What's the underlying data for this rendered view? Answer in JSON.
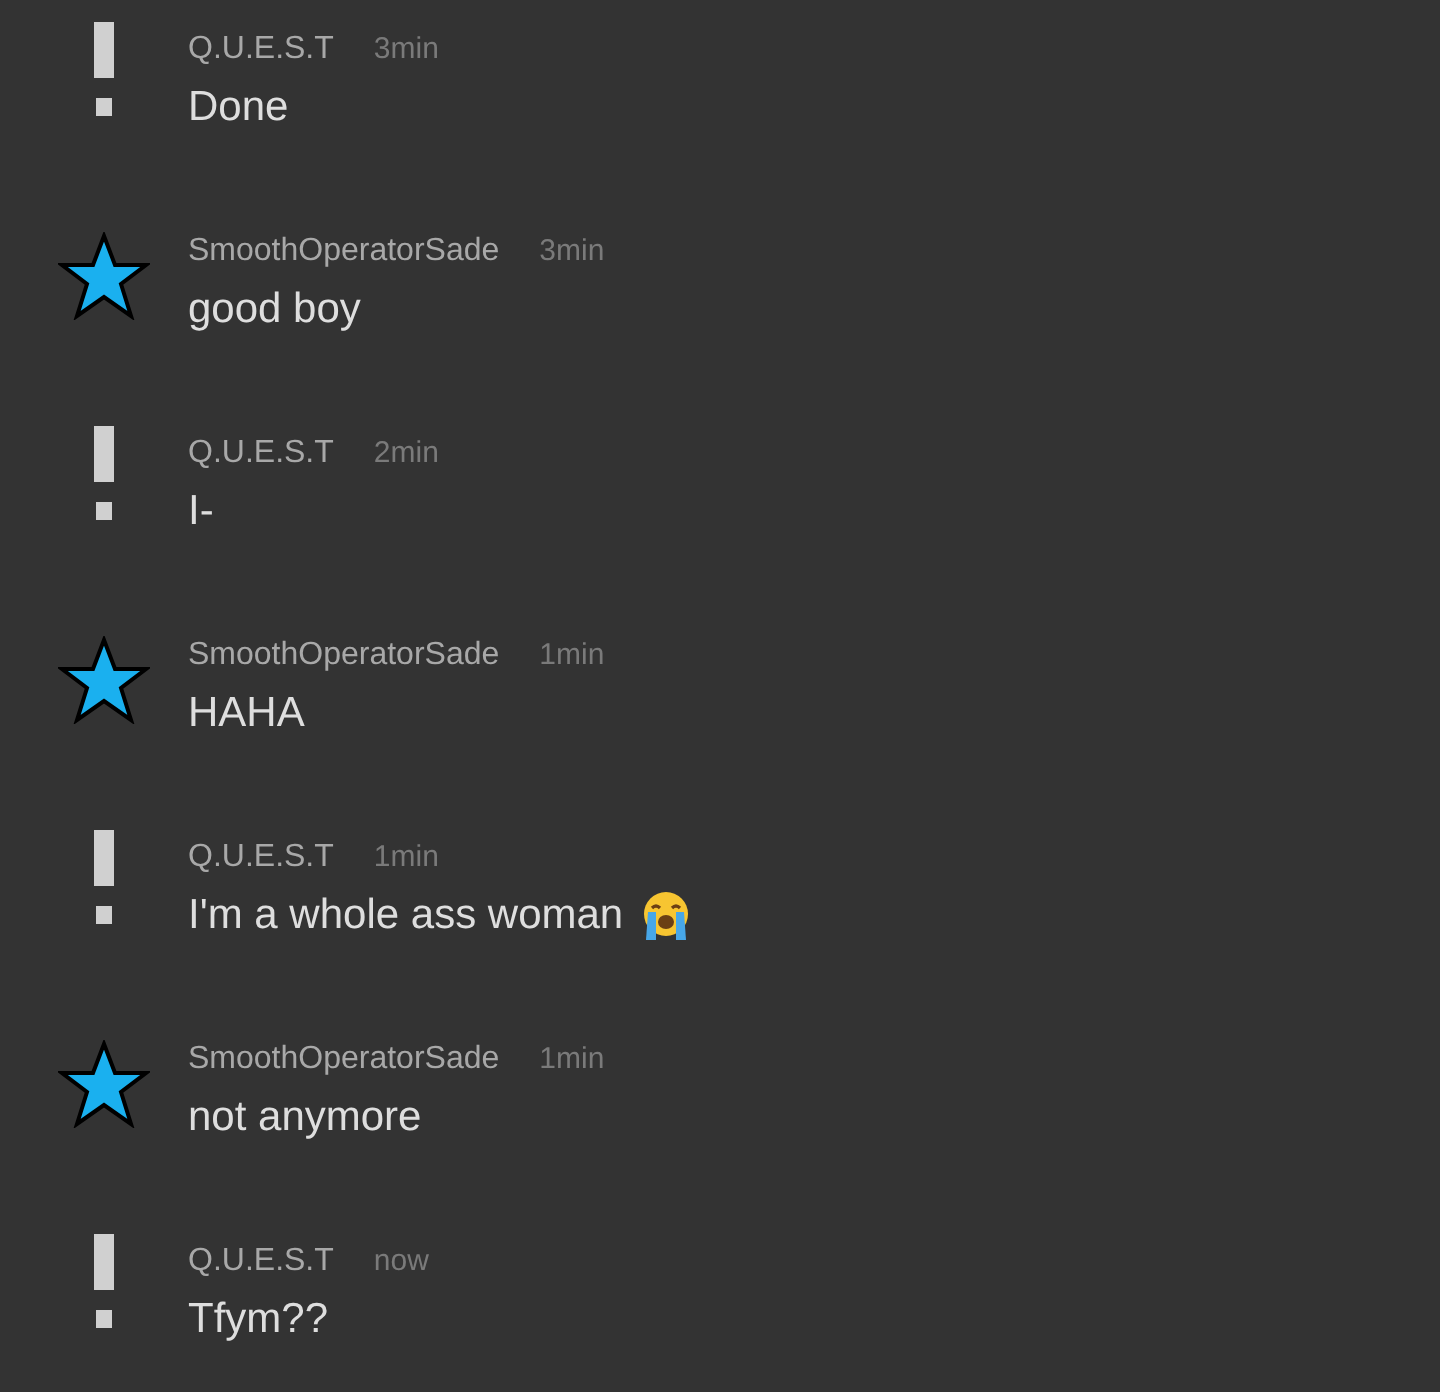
{
  "messages": [
    {
      "kind": "exclamation",
      "author": "Q.U.E.S.T",
      "time": "3min",
      "text": "Done",
      "emoji": false
    },
    {
      "kind": "star",
      "author": "SmoothOperatorSade",
      "time": "3min",
      "text": "good boy",
      "emoji": false
    },
    {
      "kind": "exclamation",
      "author": "Q.U.E.S.T",
      "time": "2min",
      "text": "I-",
      "emoji": false
    },
    {
      "kind": "star",
      "author": "SmoothOperatorSade",
      "time": "1min",
      "text": "HAHA",
      "emoji": false
    },
    {
      "kind": "exclamation",
      "author": "Q.U.E.S.T",
      "time": "1min",
      "text": "I'm a whole ass woman",
      "emoji": true
    },
    {
      "kind": "star",
      "author": "SmoothOperatorSade",
      "time": "1min",
      "text": "not anymore",
      "emoji": false
    },
    {
      "kind": "exclamation",
      "author": "Q.U.E.S.T",
      "time": "now",
      "text": "Tfym??",
      "emoji": false
    }
  ]
}
